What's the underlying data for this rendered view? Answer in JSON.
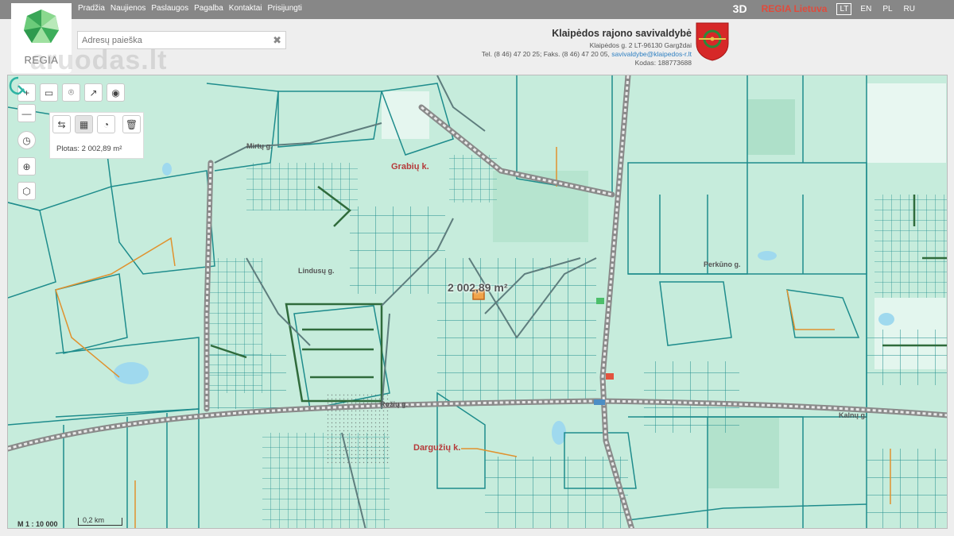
{
  "nav": {
    "items": [
      "Pradžia",
      "Naujienos",
      "Paslaugos",
      "Pagalba",
      "Kontaktai",
      "Prisijungti"
    ],
    "btn_3d": "3D",
    "regia_lietuva": "REGIA Lietuva",
    "languages": [
      "LT",
      "EN",
      "PL",
      "RU"
    ],
    "active_language": "LT"
  },
  "logo": {
    "name": "REGIA"
  },
  "watermark": "aruodas.lt",
  "search": {
    "placeholder": "Adresų paieška",
    "clear_symbol": "✖"
  },
  "municipality": {
    "title": "Klaipėdos rajono savivaldybė",
    "address": "Klaipėdos g. 2 LT-96130 Gargždai",
    "phone": "Tel. (8 46) 47 20 25; Faks. (8 46) 47 20 05,",
    "email": "savivaldybe@klaipedos-r.lt",
    "code": "Kodas: 188773688"
  },
  "map": {
    "measure_label": "2 002,89 m²",
    "area_result": "Plotas: 2 002,89 m²",
    "streets": [
      "Mirtų g.",
      "Perkūno g.",
      "Lindusų g.",
      "Rožių g.",
      "Kalnų g."
    ],
    "places": [
      "Grabių k.",
      "Dargužių k."
    ],
    "scale_text": "M 1 : 10 000",
    "scale_bar": "0,2 km"
  },
  "colors": {
    "map_bg": "#c6ecdc",
    "parcel": "#1e8c8c",
    "accent": "#e04b3c",
    "road": "#8a8a8a"
  }
}
